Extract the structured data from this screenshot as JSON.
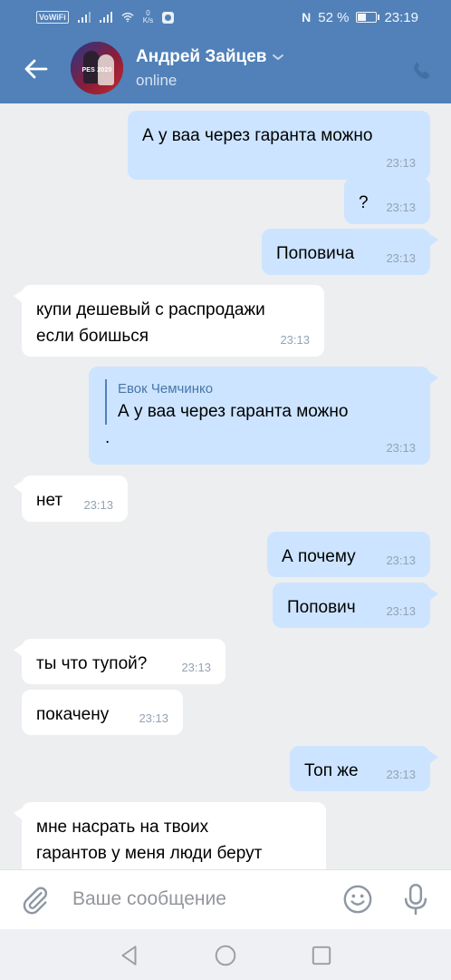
{
  "status_bar": {
    "network_badge": "VoWiFi",
    "speed_value": "0",
    "speed_unit": "K/s",
    "nfc": "N",
    "battery": "52 %",
    "battery_level": 0.52,
    "time": "23:19"
  },
  "header": {
    "avatar_text": "PES 2020",
    "contact_name": "Андрей Зайцев",
    "contact_status": "online"
  },
  "messages": [
    {
      "direction": "out",
      "text": "А у ваа через гаранта можно",
      "time": "23:13"
    },
    {
      "direction": "out",
      "text": "?",
      "time": "23:13"
    },
    {
      "direction": "out",
      "text": "Поповича",
      "time": "23:13"
    },
    {
      "direction": "in",
      "text": "купи дешевый с распродажи\nесли боишься",
      "time": "23:13"
    },
    {
      "direction": "out",
      "reply_to_name": "Евок Чемчинко",
      "reply_to_text": "А у ваа через гаранта можно",
      "text": ".",
      "time": "23:13"
    },
    {
      "direction": "in",
      "text": "нет",
      "time": "23:13"
    },
    {
      "direction": "out",
      "text": "А почему",
      "time": "23:13"
    },
    {
      "direction": "out",
      "text": "Попович",
      "time": "23:13"
    },
    {
      "direction": "in",
      "text": "ты что тупой?",
      "time": "23:13"
    },
    {
      "direction": "in",
      "text": "покачену",
      "time": "23:13"
    },
    {
      "direction": "out",
      "text": "Топ же",
      "time": "23:13"
    },
    {
      "direction": "in",
      "text": "мне насрать на твоих\nгарантов у меня люди берут",
      "time": ""
    }
  ],
  "composer": {
    "placeholder": "Ваше сообщение",
    "icons": [
      "paperclip-icon",
      "smile-icon",
      "microphone-icon"
    ]
  },
  "nav_bar": {
    "icons": [
      "back-triangle-icon",
      "home-circle-icon",
      "recents-square-icon"
    ]
  },
  "colors": {
    "header": "#5181b8",
    "outgoing_bubble": "#cce4ff",
    "incoming_bubble": "#ffffff",
    "chat_background": "#edeef0",
    "time_text": "#93a3b5"
  }
}
